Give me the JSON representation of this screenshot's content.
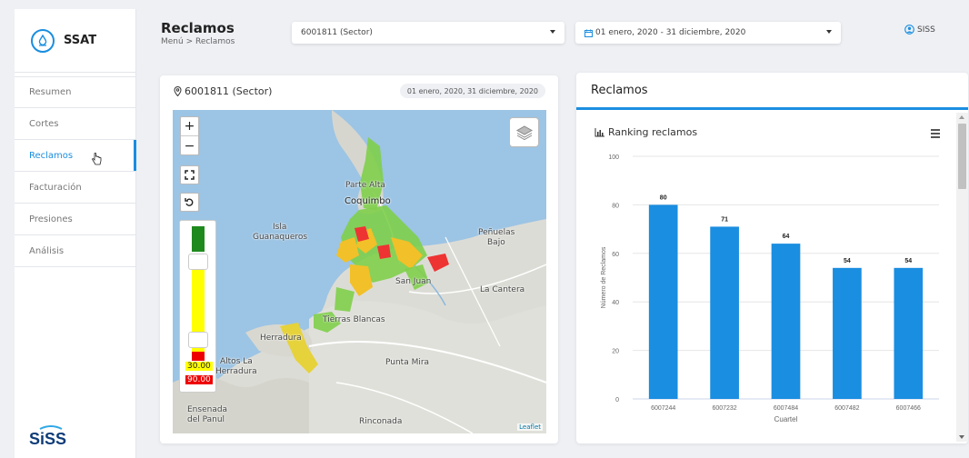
{
  "app": {
    "brand": "SSAT",
    "footer_logo": "SiSS"
  },
  "sidebar": {
    "items": [
      {
        "label": "Resumen",
        "active": false
      },
      {
        "label": "Cortes",
        "active": false
      },
      {
        "label": "Reclamos",
        "active": true
      },
      {
        "label": "Facturación",
        "active": false
      },
      {
        "label": "Presiones",
        "active": false
      },
      {
        "label": "Análisis",
        "active": false
      }
    ]
  },
  "header": {
    "title": "Reclamos",
    "breadcrumb": "Menú > Reclamos",
    "sector_select": "6001811 (Sector)",
    "date_select": "01 enero, 2020 - 31 diciembre, 2020",
    "user": "SISS"
  },
  "map_card": {
    "title": "6001811 (Sector)",
    "date_range": "01 enero, 2020, 31 diciembre, 2020",
    "labels": {
      "parte_alta": "Parte Alta",
      "coquimbo": "Coquimbo",
      "isla": "Isla",
      "guanaqueros": "Guanaqueros",
      "penuelas": "Peñuelas",
      "bajo": "Bajo",
      "san_juan": "San Juan",
      "la_cantera": "La Cantera",
      "tierras_blancas": "Tierras Blancas",
      "herradura": "Herradura",
      "altos_la": "Altos La",
      "herradura2": "Herradura",
      "punta_mira": "Punta Mira",
      "ensenada": "Ensenada",
      "del_panul": "del Panul",
      "rinconada": "Rinconada"
    },
    "threshold_low": "30.00",
    "threshold_high": "90.00",
    "attribution": "Leaflet",
    "zoom_in": "+",
    "zoom_out": "−"
  },
  "chart_card": {
    "title": "Reclamos",
    "subtitle": "Ranking reclamos"
  },
  "chart_data": {
    "type": "bar",
    "title": "Ranking reclamos",
    "xlabel": "Cuartel",
    "ylabel": "Número de Reclamos",
    "categories": [
      "6007244",
      "6007232",
      "6007484",
      "6007482",
      "6007466"
    ],
    "values": [
      80,
      71,
      64,
      54,
      54
    ],
    "ylim": [
      0,
      100
    ],
    "yticks": [
      0,
      20,
      40,
      60,
      80,
      100
    ],
    "color": "#1a8ee0",
    "grid": true,
    "legend": "none"
  }
}
